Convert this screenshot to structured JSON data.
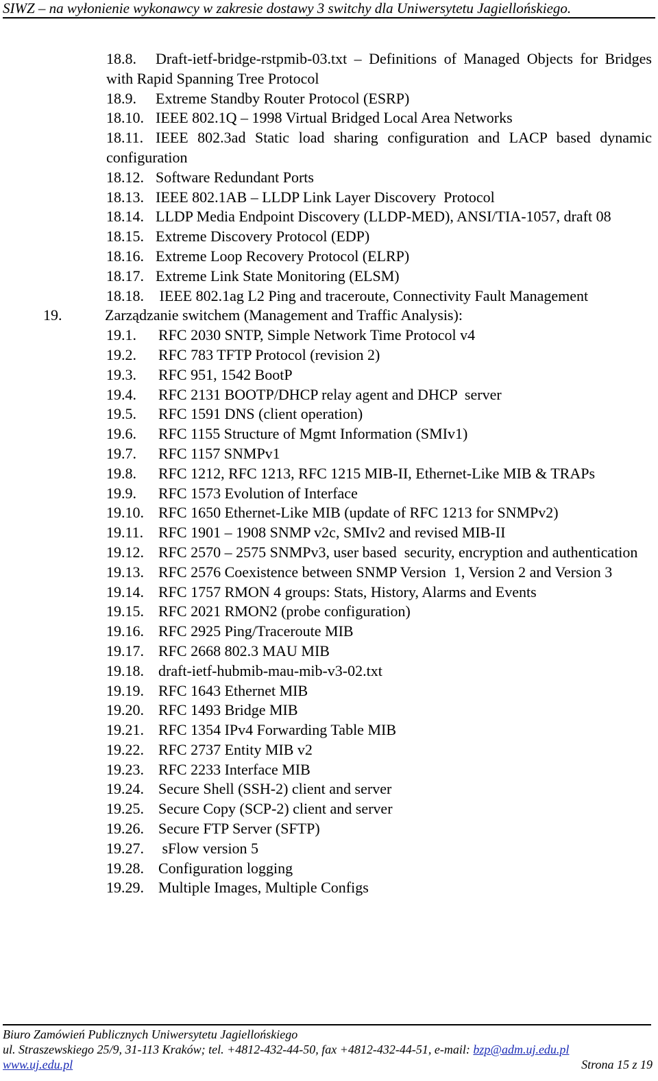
{
  "header": {
    "title": "SIWZ – na wyłonienie wykonawcy w zakresie dostawy 3 switchy dla Uniwersytetu Jagiellońskiego."
  },
  "section18_items": [
    {
      "num": "18.8.",
      "text": "Draft-ietf-bridge-rstpmib-03.txt – Definitions of Managed Objects for Bridges with Rapid Spanning Tree Protocol"
    },
    {
      "num": "18.9.",
      "text": "Extreme Standby Router Protocol (ESRP)"
    },
    {
      "num": "18.10.",
      "text": "IEEE 802.1Q – 1998 Virtual Bridged Local Area Networks"
    },
    {
      "num": "18.11.",
      "text": "IEEE 802.3ad Static load sharing configuration and LACP based dynamic configuration"
    },
    {
      "num": "18.12.",
      "text": "Software Redundant Ports"
    },
    {
      "num": "18.13.",
      "text": "IEEE 802.1AB – LLDP Link Layer Discovery  Protocol"
    },
    {
      "num": "18.14.",
      "text": "LLDP Media Endpoint Discovery (LLDP-MED), ANSI/TIA-1057, draft 08"
    },
    {
      "num": "18.15.",
      "text": "Extreme Discovery Protocol (EDP)"
    },
    {
      "num": "18.16.",
      "text": "Extreme Loop Recovery Protocol (ELRP)"
    },
    {
      "num": "18.17.",
      "text": "Extreme Link State Monitoring (ELSM)"
    },
    {
      "num": "18.18.",
      "text": " IEEE 802.1ag L2 Ping and traceroute, Connectivity Fault Management"
    }
  ],
  "section19": {
    "num": "19.",
    "title": "Zarządzanie switchem (Management and Traffic Analysis):"
  },
  "section19_items": [
    {
      "num": "19.1.",
      "text": "RFC 2030 SNTP, Simple Network Time Protocol v4"
    },
    {
      "num": "19.2.",
      "text": "RFC 783 TFTP Protocol (revision 2)"
    },
    {
      "num": "19.3.",
      "text": "RFC 951, 1542 BootP"
    },
    {
      "num": "19.4.",
      "text": "RFC 2131 BOOTP/DHCP relay agent and DHCP  server"
    },
    {
      "num": "19.5.",
      "text": "RFC 1591 DNS (client operation)"
    },
    {
      "num": "19.6.",
      "text": "RFC 1155 Structure of Mgmt Information (SMIv1)"
    },
    {
      "num": "19.7.",
      "text": "RFC 1157 SNMPv1"
    },
    {
      "num": "19.8.",
      "text": "RFC 1212, RFC 1213, RFC 1215 MIB-II, Ethernet-Like MIB & TRAPs"
    },
    {
      "num": "19.9.",
      "text": "RFC 1573 Evolution of Interface"
    },
    {
      "num": "19.10.",
      "text": "RFC 1650 Ethernet-Like MIB (update of RFC 1213 for SNMPv2)"
    },
    {
      "num": "19.11.",
      "text": "RFC 1901 – 1908 SNMP v2c, SMIv2 and revised MIB-II"
    },
    {
      "num": "19.12.",
      "text": "RFC 2570 – 2575 SNMPv3, user based  security, encryption and authentication"
    },
    {
      "num": "19.13.",
      "text": "RFC 2576 Coexistence between SNMP Version  1, Version 2 and Version 3"
    },
    {
      "num": "19.14.",
      "text": "RFC 1757 RMON 4 groups: Stats, History, Alarms and Events"
    },
    {
      "num": "19.15.",
      "text": "RFC 2021 RMON2 (probe configuration)"
    },
    {
      "num": "19.16.",
      "text": "RFC 2925 Ping/Traceroute MIB"
    },
    {
      "num": "19.17.",
      "text": "RFC 2668 802.3 MAU MIB"
    },
    {
      "num": "19.18.",
      "text": "draft-ietf-hubmib-mau-mib-v3-02.txt"
    },
    {
      "num": "19.19.",
      "text": "RFC 1643 Ethernet MIB"
    },
    {
      "num": "19.20.",
      "text": "RFC 1493 Bridge MIB"
    },
    {
      "num": "19.21.",
      "text": "RFC 1354 IPv4 Forwarding Table MIB"
    },
    {
      "num": "19.22.",
      "text": "RFC 2737 Entity MIB v2"
    },
    {
      "num": "19.23.",
      "text": "RFC 2233 Interface MIB"
    },
    {
      "num": "19.24.",
      "text": "Secure Shell (SSH-2) client and server"
    },
    {
      "num": "19.25.",
      "text": "Secure Copy (SCP-2) client and server"
    },
    {
      "num": "19.26.",
      "text": "Secure FTP Server (SFTP)"
    },
    {
      "num": "19.27.",
      "text": " sFlow version 5"
    },
    {
      "num": "19.28.",
      "text": "Configuration logging"
    },
    {
      "num": "19.29.",
      "text": "Multiple Images, Multiple Configs"
    }
  ],
  "footer": {
    "org": "Biuro Zamówień Publicznych Uniwersytetu Jagiellońskiego",
    "address": "ul. Straszewskiego 25/9, 31-113 Kraków; tel. +4812-432-44-50, fax +4812-432-44-51, e-mail: ",
    "email": "bzp@adm.uj.edu.pl",
    "website": "www.uj.edu.pl",
    "page": "Strona 15 z 19",
    "link_color": "#1a2bb5"
  }
}
